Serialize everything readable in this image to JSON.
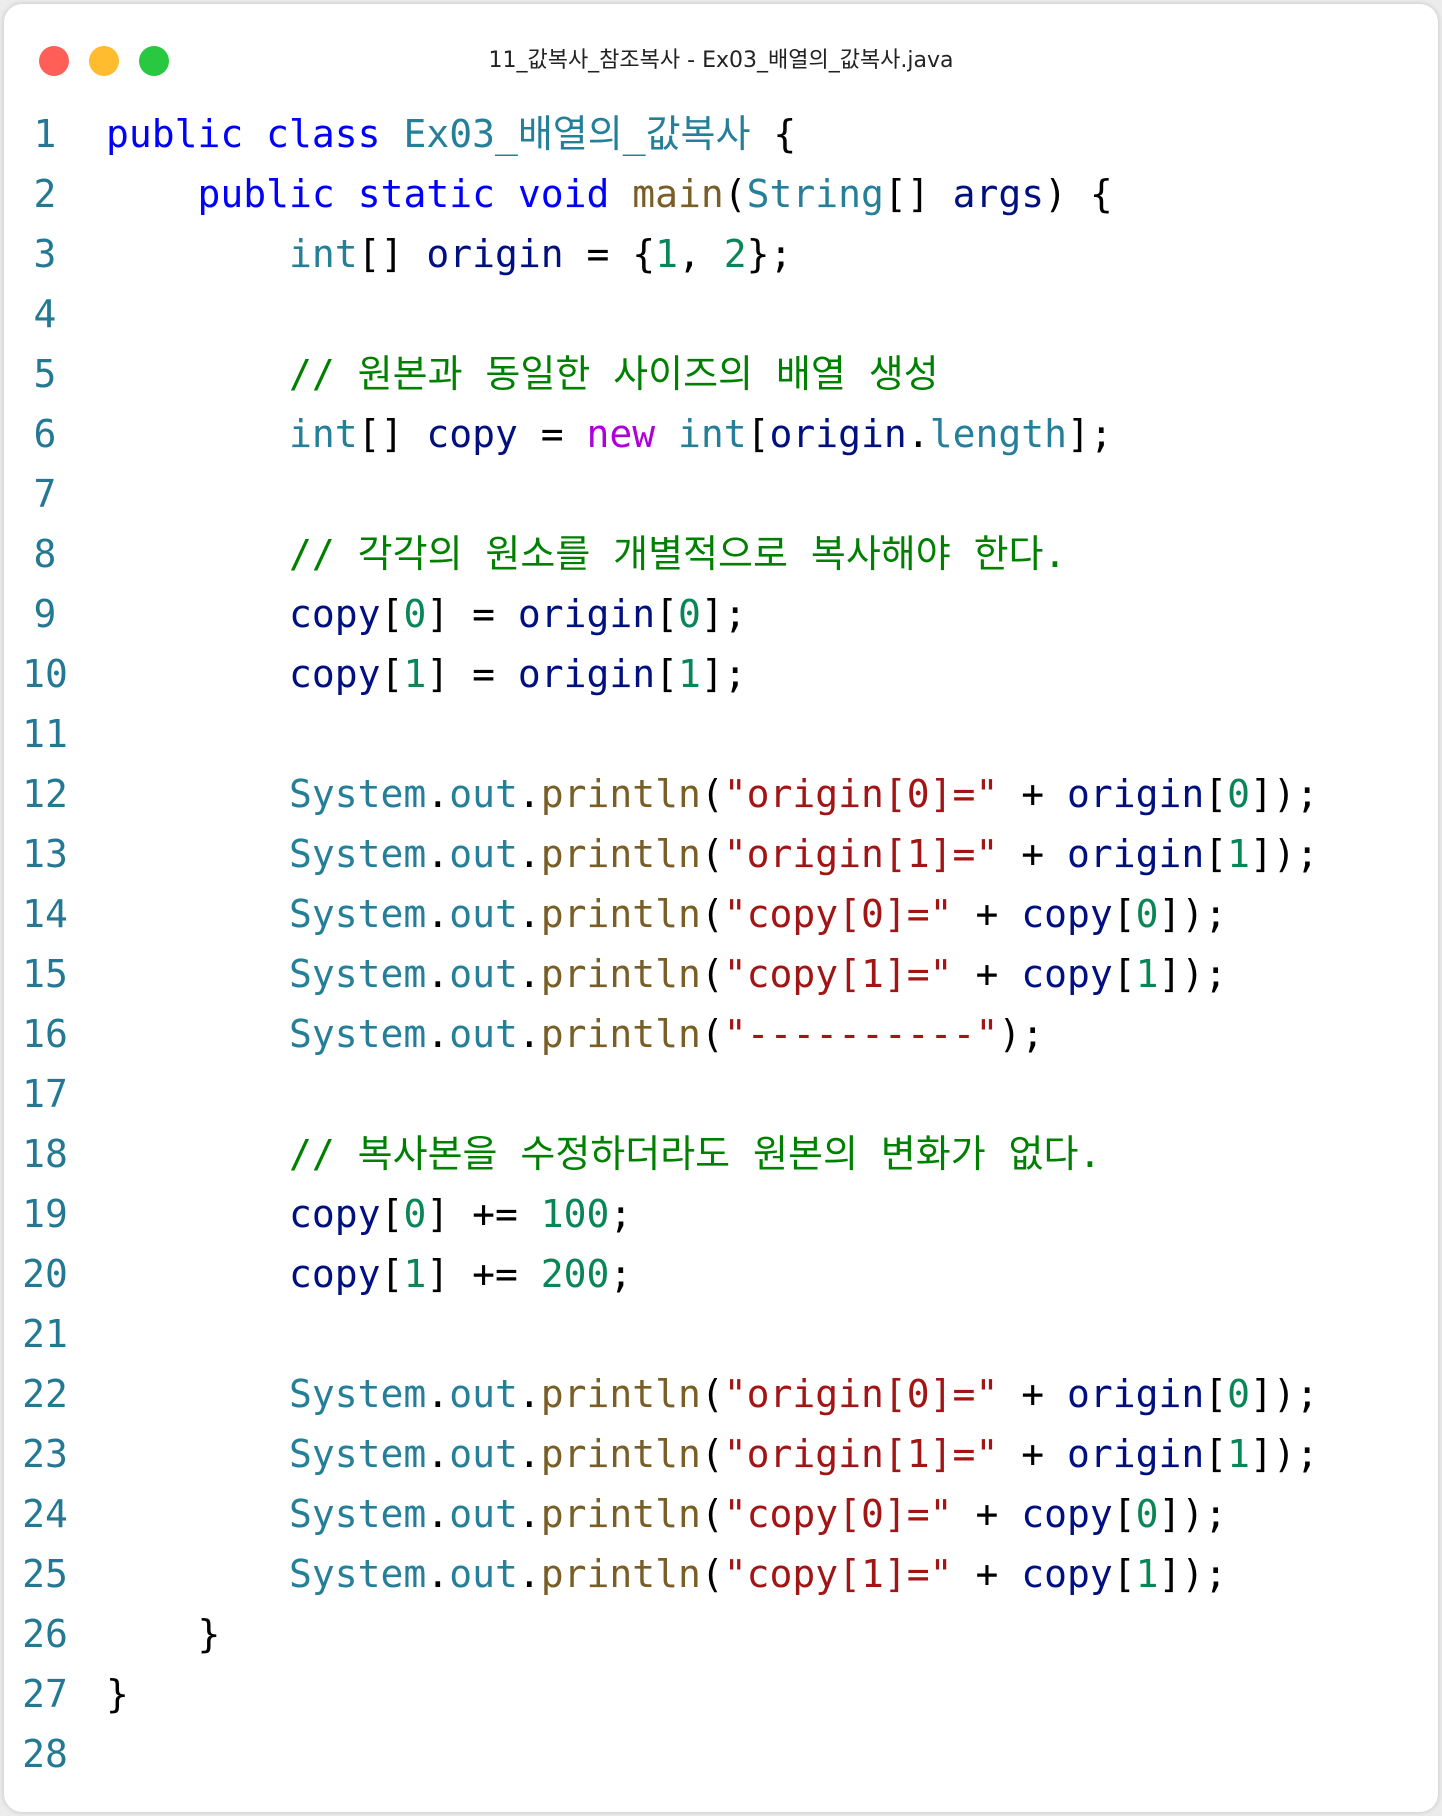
{
  "window": {
    "title": "11_값복사_참조복사 - Ex03_배열의_값복사.java"
  },
  "code": {
    "lines": [
      {
        "n": "1",
        "tokens": [
          [
            "kw",
            "public"
          ],
          [
            "pn",
            " "
          ],
          [
            "kw",
            "class"
          ],
          [
            "pn",
            " "
          ],
          [
            "ty",
            "Ex03_배열의_값복사"
          ],
          [
            "pn",
            " {"
          ]
        ]
      },
      {
        "n": "2",
        "tokens": [
          [
            "pn",
            "    "
          ],
          [
            "kw",
            "public"
          ],
          [
            "pn",
            " "
          ],
          [
            "kw",
            "static"
          ],
          [
            "pn",
            " "
          ],
          [
            "kw",
            "void"
          ],
          [
            "pn",
            " "
          ],
          [
            "fn",
            "main"
          ],
          [
            "pn",
            "("
          ],
          [
            "ty",
            "String"
          ],
          [
            "pn",
            "[] "
          ],
          [
            "vr",
            "args"
          ],
          [
            "pn",
            ") {"
          ]
        ]
      },
      {
        "n": "3",
        "tokens": [
          [
            "pn",
            "        "
          ],
          [
            "ty",
            "int"
          ],
          [
            "pn",
            "[] "
          ],
          [
            "vr",
            "origin"
          ],
          [
            "pn",
            " = {"
          ],
          [
            "num",
            "1"
          ],
          [
            "pn",
            ", "
          ],
          [
            "num",
            "2"
          ],
          [
            "pn",
            "};"
          ]
        ]
      },
      {
        "n": "4",
        "tokens": []
      },
      {
        "n": "5",
        "tokens": [
          [
            "pn",
            "        "
          ],
          [
            "cm",
            "// 원본과 동일한 사이즈의 배열 생성"
          ]
        ]
      },
      {
        "n": "6",
        "tokens": [
          [
            "pn",
            "        "
          ],
          [
            "ty",
            "int"
          ],
          [
            "pn",
            "[] "
          ],
          [
            "vr",
            "copy"
          ],
          [
            "pn",
            " = "
          ],
          [
            "nw",
            "new"
          ],
          [
            "pn",
            " "
          ],
          [
            "ty",
            "int"
          ],
          [
            "pn",
            "["
          ],
          [
            "vr",
            "origin"
          ],
          [
            "pn",
            "."
          ],
          [
            "ty",
            "length"
          ],
          [
            "pn",
            "];"
          ]
        ]
      },
      {
        "n": "7",
        "tokens": []
      },
      {
        "n": "8",
        "tokens": [
          [
            "pn",
            "        "
          ],
          [
            "cm",
            "// 각각의 원소를 개별적으로 복사해야 한다."
          ]
        ]
      },
      {
        "n": "9",
        "tokens": [
          [
            "pn",
            "        "
          ],
          [
            "vr",
            "copy"
          ],
          [
            "pn",
            "["
          ],
          [
            "num",
            "0"
          ],
          [
            "pn",
            "] = "
          ],
          [
            "vr",
            "origin"
          ],
          [
            "pn",
            "["
          ],
          [
            "num",
            "0"
          ],
          [
            "pn",
            "];"
          ]
        ]
      },
      {
        "n": "10",
        "tokens": [
          [
            "pn",
            "        "
          ],
          [
            "vr",
            "copy"
          ],
          [
            "pn",
            "["
          ],
          [
            "num",
            "1"
          ],
          [
            "pn",
            "] = "
          ],
          [
            "vr",
            "origin"
          ],
          [
            "pn",
            "["
          ],
          [
            "num",
            "1"
          ],
          [
            "pn",
            "];"
          ]
        ]
      },
      {
        "n": "11",
        "tokens": []
      },
      {
        "n": "12",
        "tokens": [
          [
            "pn",
            "        "
          ],
          [
            "ty",
            "System"
          ],
          [
            "pn",
            "."
          ],
          [
            "ty",
            "out"
          ],
          [
            "pn",
            "."
          ],
          [
            "fn",
            "println"
          ],
          [
            "pn",
            "("
          ],
          [
            "st",
            "\"origin[0]=\""
          ],
          [
            "pn",
            " + "
          ],
          [
            "vr",
            "origin"
          ],
          [
            "pn",
            "["
          ],
          [
            "num",
            "0"
          ],
          [
            "pn",
            "]);"
          ]
        ]
      },
      {
        "n": "13",
        "tokens": [
          [
            "pn",
            "        "
          ],
          [
            "ty",
            "System"
          ],
          [
            "pn",
            "."
          ],
          [
            "ty",
            "out"
          ],
          [
            "pn",
            "."
          ],
          [
            "fn",
            "println"
          ],
          [
            "pn",
            "("
          ],
          [
            "st",
            "\"origin[1]=\""
          ],
          [
            "pn",
            " + "
          ],
          [
            "vr",
            "origin"
          ],
          [
            "pn",
            "["
          ],
          [
            "num",
            "1"
          ],
          [
            "pn",
            "]);"
          ]
        ]
      },
      {
        "n": "14",
        "tokens": [
          [
            "pn",
            "        "
          ],
          [
            "ty",
            "System"
          ],
          [
            "pn",
            "."
          ],
          [
            "ty",
            "out"
          ],
          [
            "pn",
            "."
          ],
          [
            "fn",
            "println"
          ],
          [
            "pn",
            "("
          ],
          [
            "st",
            "\"copy[0]=\""
          ],
          [
            "pn",
            " + "
          ],
          [
            "vr",
            "copy"
          ],
          [
            "pn",
            "["
          ],
          [
            "num",
            "0"
          ],
          [
            "pn",
            "]);"
          ]
        ]
      },
      {
        "n": "15",
        "tokens": [
          [
            "pn",
            "        "
          ],
          [
            "ty",
            "System"
          ],
          [
            "pn",
            "."
          ],
          [
            "ty",
            "out"
          ],
          [
            "pn",
            "."
          ],
          [
            "fn",
            "println"
          ],
          [
            "pn",
            "("
          ],
          [
            "st",
            "\"copy[1]=\""
          ],
          [
            "pn",
            " + "
          ],
          [
            "vr",
            "copy"
          ],
          [
            "pn",
            "["
          ],
          [
            "num",
            "1"
          ],
          [
            "pn",
            "]);"
          ]
        ]
      },
      {
        "n": "16",
        "tokens": [
          [
            "pn",
            "        "
          ],
          [
            "ty",
            "System"
          ],
          [
            "pn",
            "."
          ],
          [
            "ty",
            "out"
          ],
          [
            "pn",
            "."
          ],
          [
            "fn",
            "println"
          ],
          [
            "pn",
            "("
          ],
          [
            "st",
            "\"----------\""
          ],
          [
            "pn",
            ");"
          ]
        ]
      },
      {
        "n": "17",
        "tokens": []
      },
      {
        "n": "18",
        "tokens": [
          [
            "pn",
            "        "
          ],
          [
            "cm",
            "// 복사본을 수정하더라도 원본의 변화가 없다."
          ]
        ]
      },
      {
        "n": "19",
        "tokens": [
          [
            "pn",
            "        "
          ],
          [
            "vr",
            "copy"
          ],
          [
            "pn",
            "["
          ],
          [
            "num",
            "0"
          ],
          [
            "pn",
            "] += "
          ],
          [
            "num",
            "100"
          ],
          [
            "pn",
            ";"
          ]
        ]
      },
      {
        "n": "20",
        "tokens": [
          [
            "pn",
            "        "
          ],
          [
            "vr",
            "copy"
          ],
          [
            "pn",
            "["
          ],
          [
            "num",
            "1"
          ],
          [
            "pn",
            "] += "
          ],
          [
            "num",
            "200"
          ],
          [
            "pn",
            ";"
          ]
        ]
      },
      {
        "n": "21",
        "tokens": []
      },
      {
        "n": "22",
        "tokens": [
          [
            "pn",
            "        "
          ],
          [
            "ty",
            "System"
          ],
          [
            "pn",
            "."
          ],
          [
            "ty",
            "out"
          ],
          [
            "pn",
            "."
          ],
          [
            "fn",
            "println"
          ],
          [
            "pn",
            "("
          ],
          [
            "st",
            "\"origin[0]=\""
          ],
          [
            "pn",
            " + "
          ],
          [
            "vr",
            "origin"
          ],
          [
            "pn",
            "["
          ],
          [
            "num",
            "0"
          ],
          [
            "pn",
            "]);"
          ]
        ]
      },
      {
        "n": "23",
        "tokens": [
          [
            "pn",
            "        "
          ],
          [
            "ty",
            "System"
          ],
          [
            "pn",
            "."
          ],
          [
            "ty",
            "out"
          ],
          [
            "pn",
            "."
          ],
          [
            "fn",
            "println"
          ],
          [
            "pn",
            "("
          ],
          [
            "st",
            "\"origin[1]=\""
          ],
          [
            "pn",
            " + "
          ],
          [
            "vr",
            "origin"
          ],
          [
            "pn",
            "["
          ],
          [
            "num",
            "1"
          ],
          [
            "pn",
            "]);"
          ]
        ]
      },
      {
        "n": "24",
        "tokens": [
          [
            "pn",
            "        "
          ],
          [
            "ty",
            "System"
          ],
          [
            "pn",
            "."
          ],
          [
            "ty",
            "out"
          ],
          [
            "pn",
            "."
          ],
          [
            "fn",
            "println"
          ],
          [
            "pn",
            "("
          ],
          [
            "st",
            "\"copy[0]=\""
          ],
          [
            "pn",
            " + "
          ],
          [
            "vr",
            "copy"
          ],
          [
            "pn",
            "["
          ],
          [
            "num",
            "0"
          ],
          [
            "pn",
            "]);"
          ]
        ]
      },
      {
        "n": "25",
        "tokens": [
          [
            "pn",
            "        "
          ],
          [
            "ty",
            "System"
          ],
          [
            "pn",
            "."
          ],
          [
            "ty",
            "out"
          ],
          [
            "pn",
            "."
          ],
          [
            "fn",
            "println"
          ],
          [
            "pn",
            "("
          ],
          [
            "st",
            "\"copy[1]=\""
          ],
          [
            "pn",
            " + "
          ],
          [
            "vr",
            "copy"
          ],
          [
            "pn",
            "["
          ],
          [
            "num",
            "1"
          ],
          [
            "pn",
            "]);"
          ]
        ]
      },
      {
        "n": "26",
        "tokens": [
          [
            "pn",
            "    }"
          ]
        ]
      },
      {
        "n": "27",
        "tokens": [
          [
            "pn",
            "}"
          ]
        ]
      },
      {
        "n": "28",
        "tokens": []
      }
    ]
  }
}
